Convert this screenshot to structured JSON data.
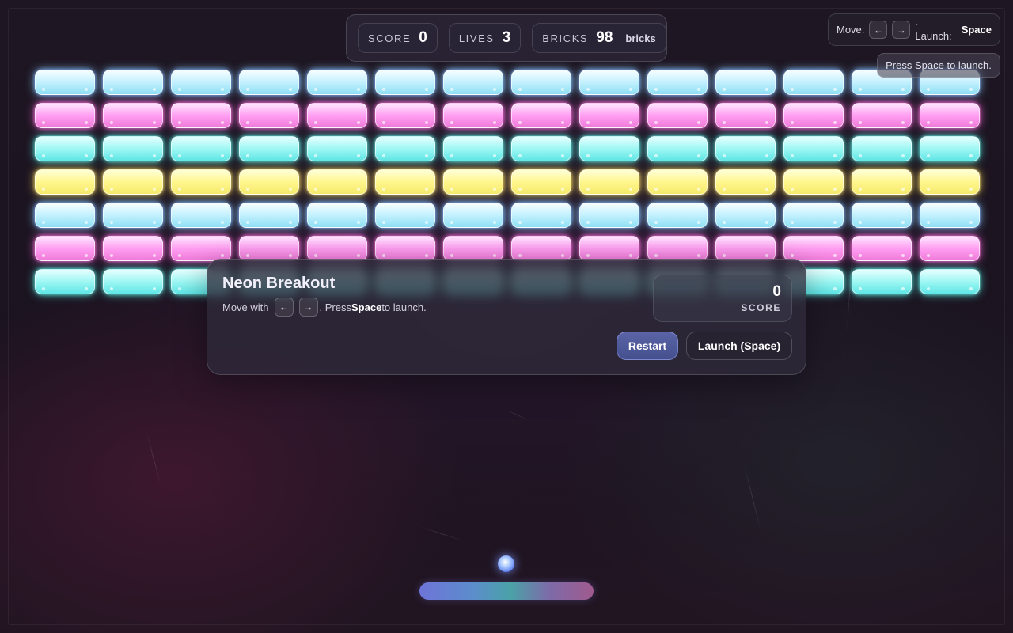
{
  "hud": {
    "score_label": "SCORE",
    "score_value": "0",
    "lives_label": "LIVES",
    "lives_value": "3",
    "bricks_label": "BRICKS",
    "bricks_value": "98",
    "bricks_unit": "bricks"
  },
  "controls": {
    "move_label": "Move:",
    "left_key": "←",
    "right_key": "→",
    "launch_label": "· Launch:",
    "launch_key": "Space",
    "toast": "Press Space to launch."
  },
  "board": {
    "rows": 7,
    "columns": 14,
    "row_colors": [
      "ice",
      "pink",
      "cyan",
      "yellow",
      "ice",
      "pink",
      "cyan"
    ],
    "color_hex": {
      "ice": "#bdeeff",
      "pink": "#ff9ff2",
      "cyan": "#9ef7f3",
      "yellow": "#fff68e"
    }
  },
  "dialog": {
    "title": "Neon Breakout",
    "hint_prefix": "Move with",
    "hint_left_key": "←",
    "hint_right_key": "→",
    "hint_middle": ". Press",
    "hint_space_key": "Space",
    "hint_suffix": "to launch.",
    "score_value": "0",
    "score_label": "SCORE",
    "restart_label": "Restart",
    "launch_label": "Launch (Space)"
  },
  "paddle": {
    "gradient": [
      "#6e74d8",
      "#4aa2a8",
      "#a05a8e"
    ]
  },
  "ball": {
    "color": "#5a7ef0"
  }
}
